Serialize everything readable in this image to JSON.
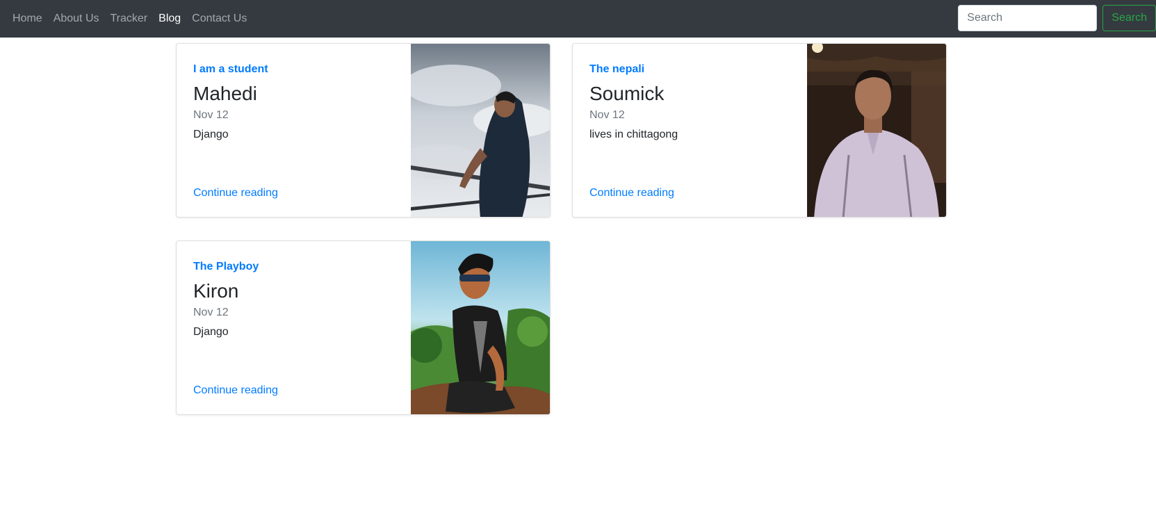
{
  "nav": {
    "items": [
      "Home",
      "About Us",
      "Tracker",
      "Blog",
      "Contact Us"
    ],
    "active": "Blog"
  },
  "search": {
    "placeholder": "Search",
    "button_label": "Search"
  },
  "posts": [
    {
      "category": "I am a student",
      "title": "Mahedi",
      "date": "Nov 12",
      "excerpt": "Django",
      "link": "Continue reading"
    },
    {
      "category": "The nepali",
      "title": "Soumick",
      "date": "Nov 12",
      "excerpt": "lives in chittagong",
      "link": "Continue reading"
    },
    {
      "category": "The Playboy",
      "title": "Kiron",
      "date": "Nov 12",
      "excerpt": "Django",
      "link": "Continue reading"
    }
  ],
  "colors": {
    "navbar": "#343a40",
    "link": "#007bff",
    "success": "#28a745"
  }
}
